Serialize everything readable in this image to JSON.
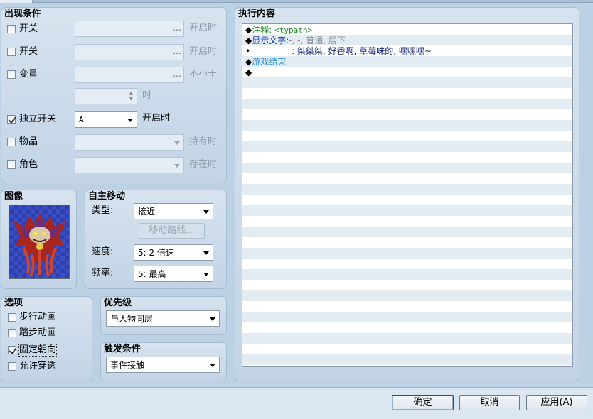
{
  "conditions": {
    "title": "出现条件",
    "switch1": {
      "label": "开关",
      "value": "",
      "suffix": "开启时",
      "checked": false
    },
    "switch2": {
      "label": "开关",
      "value": "",
      "suffix": "开启时",
      "checked": false
    },
    "variable": {
      "label": "变量",
      "value": "",
      "suffix": "不小于",
      "checked": false
    },
    "variable_value": {
      "value": "",
      "suffix": "时"
    },
    "self_switch": {
      "label": "独立开关",
      "value": "A",
      "suffix": "开启时",
      "checked": true
    },
    "item": {
      "label": "物品",
      "value": "",
      "suffix": "持有时",
      "checked": false
    },
    "actor": {
      "label": "角色",
      "value": "",
      "suffix": "存在时",
      "checked": false
    }
  },
  "image": {
    "title": "图像",
    "icon": "demon-sprite"
  },
  "autonomous": {
    "title": "自主移动",
    "type_label": "类型:",
    "type_value": "接近",
    "route_button": "移动路线...",
    "speed_label": "速度:",
    "speed_value": "5: 2 倍速",
    "freq_label": "频率:",
    "freq_value": "5: 最高"
  },
  "options": {
    "title": "选项",
    "walk": {
      "label": "步行动画",
      "checked": false
    },
    "step": {
      "label": "踏步动画",
      "checked": false
    },
    "fixed": {
      "label": "固定朝向",
      "checked": true
    },
    "through": {
      "label": "允许穿透",
      "checked": false
    }
  },
  "priority": {
    "title": "优先级",
    "value": "与人物同层"
  },
  "trigger": {
    "title": "触发条件",
    "value": "事件接触"
  },
  "contents": {
    "title": "执行内容",
    "lines": [
      {
        "marker": "◆",
        "label": "注释:",
        "text": "<typath>"
      },
      {
        "marker": "◆",
        "label": "显示文字:",
        "text": "-, -, 普通, 居下"
      },
      {
        "marker": "•",
        "label": ":",
        "text": "桀桀桀, 好香啊, 草莓味的, 嘿嘿嘿~"
      },
      {
        "marker": "◆",
        "label": "游戏结束",
        "text": ""
      },
      {
        "marker": "◆",
        "label": "",
        "text": ""
      }
    ]
  },
  "buttons": {
    "ok": "确定",
    "cancel": "取消",
    "apply": "应用(A)"
  },
  "colors": {
    "comment": "#1d8a24",
    "command": "#173ea8",
    "param": "#8590a0",
    "message": "#1a2a7c",
    "gameover": "#2a8fd6"
  }
}
